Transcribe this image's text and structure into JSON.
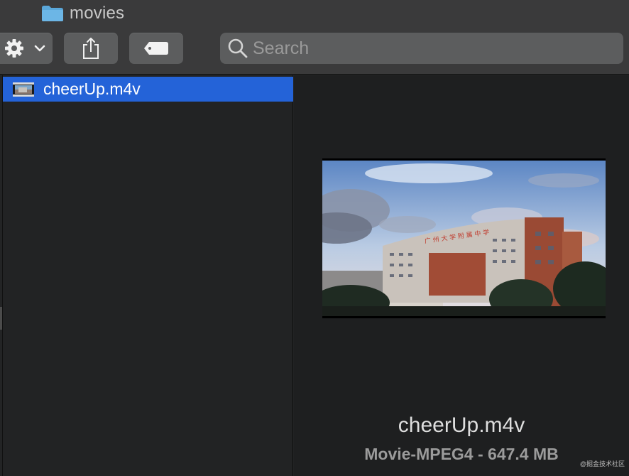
{
  "window": {
    "title": "movies",
    "icons": {
      "title": "folder-icon"
    }
  },
  "toolbar": {
    "action_icon": "gear-icon",
    "action_menu_icon": "chevron-down-icon",
    "share_icon": "share-icon",
    "tag_icon": "tag-icon"
  },
  "search": {
    "placeholder": "Search",
    "value": "",
    "icon": "search-icon"
  },
  "file_list": {
    "items": [
      {
        "name": "cheerUp.m4v",
        "icon": "video-file-icon",
        "selected": true
      }
    ],
    "selection_color": "#2463d8"
  },
  "preview": {
    "thumbnail": "video-thumbnail-icon",
    "file_name": "cheerUp.m4v",
    "meta": "Movie-MPEG4 - 647.4 MB",
    "thumbnail_caption": "广 州 大 学 附 属 中 学"
  },
  "watermark": "@掘金技术社区"
}
